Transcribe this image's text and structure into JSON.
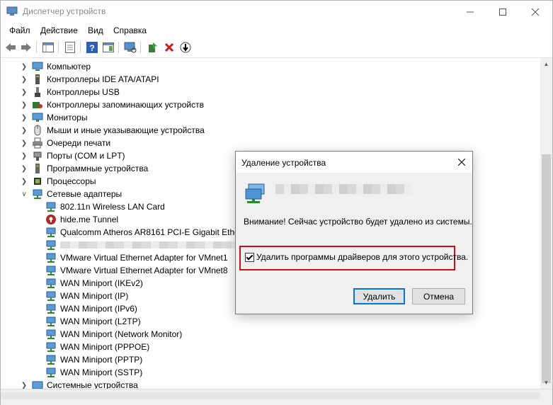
{
  "window": {
    "title": "Диспетчер устройств"
  },
  "menu": [
    "Файл",
    "Действие",
    "Вид",
    "Справка"
  ],
  "tree": {
    "categories": [
      "Компьютер",
      "Контроллеры IDE ATA/ATAPI",
      "Контроллеры USB",
      "Контроллеры запоминающих устройств",
      "Мониторы",
      "Мыши и иные указывающие устройства",
      "Очереди печати",
      "Порты (COM и LPT)",
      "Программные устройства",
      "Процессоры",
      "Сетевые адаптеры"
    ],
    "adapters": [
      "802.11n Wireless LAN Card",
      "hide.me Tunnel",
      "Qualcomm Atheros AR8161 PCI-E Gigabit Ethernet",
      "",
      "VMware Virtual Ethernet Adapter for VMnet1",
      "VMware Virtual Ethernet Adapter for VMnet8",
      "WAN Miniport (IKEv2)",
      "WAN Miniport (IP)",
      "WAN Miniport (IPv6)",
      "WAN Miniport (L2TP)",
      "WAN Miniport (Network Monitor)",
      "WAN Miniport (PPPOE)",
      "WAN Miniport (PPTP)",
      "WAN Miniport (SSTP)"
    ],
    "last_category": "Системные устройства"
  },
  "dialog": {
    "title": "Удаление устройства",
    "warning": "Внимание! Сейчас устройство будет удалено из системы.",
    "checkbox_label": "Удалить программы драйверов для этого устройства.",
    "checkbox_checked": true,
    "ok_label": "Удалить",
    "cancel_label": "Отмена"
  },
  "colors": {
    "accent": "#0078d7",
    "highlight_border": "#d01010"
  }
}
